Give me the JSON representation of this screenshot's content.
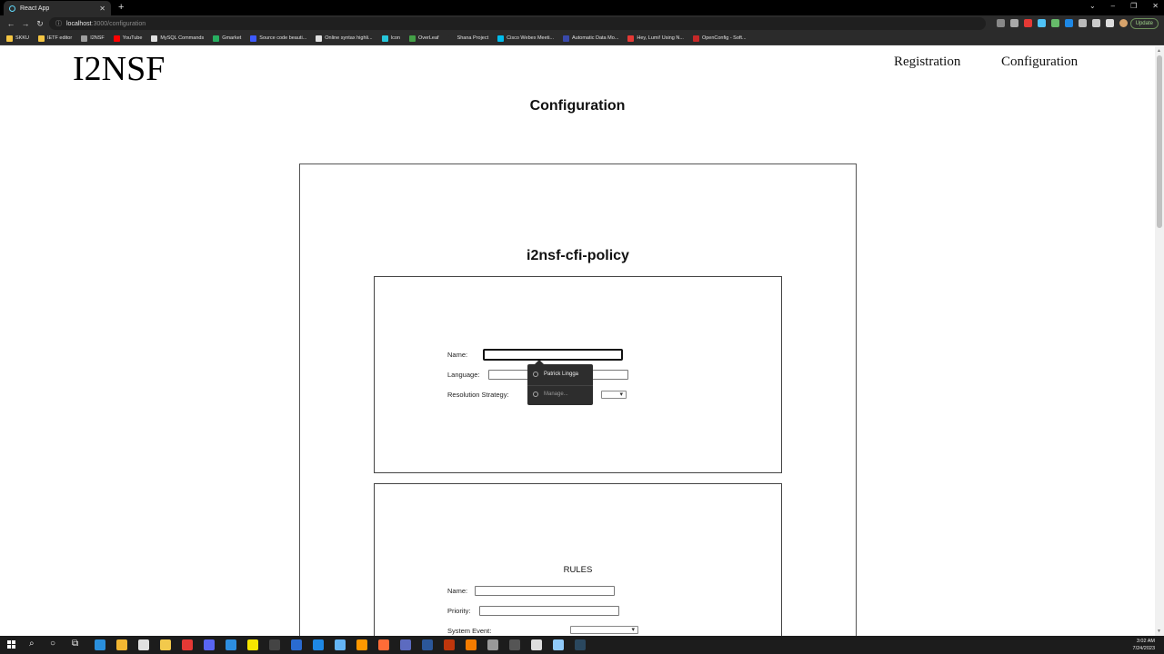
{
  "browser": {
    "tab_title": "React App",
    "new_tab": "+",
    "window_controls": [
      "⌄",
      "–",
      "❐",
      "✕"
    ],
    "url_host": "localhost",
    "url_path": ":3000/configuration",
    "update_label": "Update",
    "bookmarks": [
      {
        "label": "SKKU",
        "color": "#f4c542"
      },
      {
        "label": "IETF editor",
        "color": "#f4c542"
      },
      {
        "label": "I2NSF",
        "color": "#9e9e9e"
      },
      {
        "label": "YouTube",
        "color": "#ff0000"
      },
      {
        "label": "MySQL Commands",
        "color": "#e0e0e0"
      },
      {
        "label": "Gmarket",
        "color": "#27ae60"
      },
      {
        "label": "Source code beauti...",
        "color": "#3d5afe"
      },
      {
        "label": "Online syntax highli...",
        "color": "#e0e0e0"
      },
      {
        "label": "Icon",
        "color": "#26c6da"
      },
      {
        "label": "OverLeaf",
        "color": "#43a047"
      },
      {
        "label": "Shana Project",
        "color": "#2b2b2b"
      },
      {
        "label": "Cisco Webex Meeti...",
        "color": "#00bceb"
      },
      {
        "label": "Automatic Data Mo...",
        "color": "#3949ab"
      },
      {
        "label": "Hey, Lumi! Using N...",
        "color": "#e53935"
      },
      {
        "label": "OpenConfig - Soft...",
        "color": "#c62828"
      }
    ]
  },
  "site": {
    "logo": "I2NSF",
    "nav": {
      "registration": "Registration",
      "configuration": "Configuration"
    }
  },
  "page_title": "Configuration",
  "policy": {
    "title": "i2nsf-cfi-policy",
    "name_label": "Name:",
    "name_value": "",
    "language_label": "Language:",
    "language_value": "",
    "resolution_label": "Resolution Strategy:",
    "resolution_value": ""
  },
  "autofill": {
    "suggestion": "Patrick Lingga",
    "manage": "Manage..."
  },
  "rules": {
    "title": "RULES",
    "name_label": "Name:",
    "priority_label": "Priority:",
    "system_event_label": "System Event:"
  },
  "taskbar": {
    "time": "3:02 AM",
    "date": "7/24/2023",
    "apps": [
      {
        "name": "edge",
        "color": "#2a8fdc"
      },
      {
        "name": "file-explorer",
        "color": "#f2b632"
      },
      {
        "name": "chrome",
        "color": "#e0e0e0"
      },
      {
        "name": "folder",
        "color": "#f2c94c"
      },
      {
        "name": "media",
        "color": "#e53935"
      },
      {
        "name": "discord",
        "color": "#5865f2"
      },
      {
        "name": "vscode",
        "color": "#2d8ee0"
      },
      {
        "name": "kakao",
        "color": "#f7e600"
      },
      {
        "name": "terminal",
        "color": "#444444"
      },
      {
        "name": "powershell",
        "color": "#2a6bd1"
      },
      {
        "name": "mail",
        "color": "#1e88e5"
      },
      {
        "name": "notepad",
        "color": "#64b5f6"
      },
      {
        "name": "sublime",
        "color": "#ff9800"
      },
      {
        "name": "postman",
        "color": "#ff6c37"
      },
      {
        "name": "teams",
        "color": "#5c6bc0"
      },
      {
        "name": "word",
        "color": "#2b579a"
      },
      {
        "name": "filezilla",
        "color": "#bf360c"
      },
      {
        "name": "vlc",
        "color": "#f57c00"
      },
      {
        "name": "gitkraken",
        "color": "#999999"
      },
      {
        "name": "calculator",
        "color": "#555555"
      },
      {
        "name": "github",
        "color": "#dddddd"
      },
      {
        "name": "network",
        "color": "#90caf9"
      },
      {
        "name": "steam",
        "color": "#2a475e"
      }
    ]
  }
}
